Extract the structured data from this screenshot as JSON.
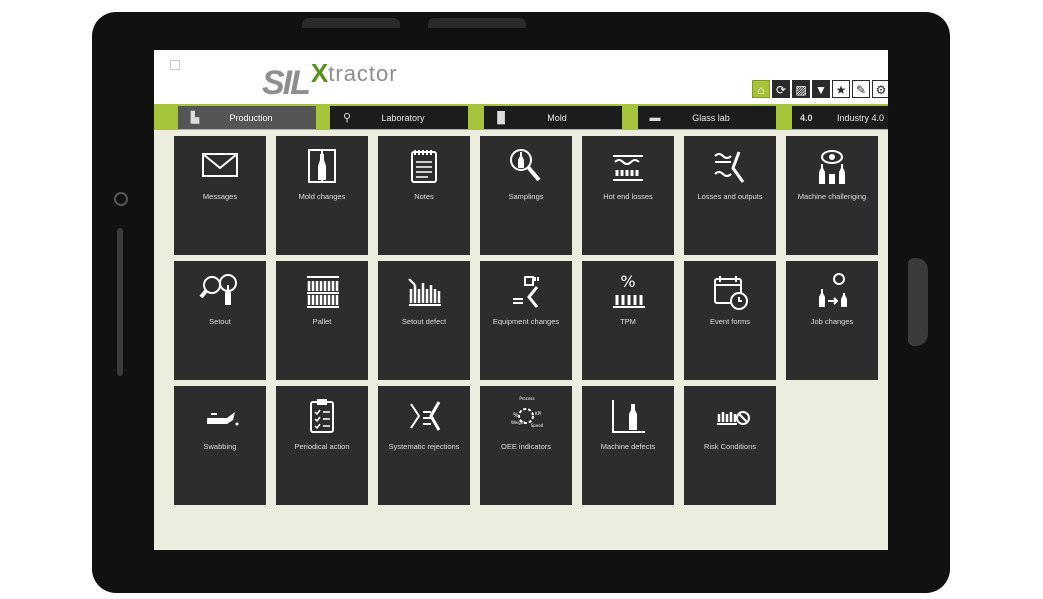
{
  "header": {
    "logo_sil": "SIL",
    "logo_x": "X",
    "logo_rest": "tractor"
  },
  "toolbar": [
    {
      "name": "home-button",
      "icon": "home-icon",
      "glyph": "⌂"
    },
    {
      "name": "refresh-button",
      "icon": "refresh-icon",
      "glyph": "⟳"
    },
    {
      "name": "image-button",
      "icon": "image-icon",
      "glyph": "▨"
    },
    {
      "name": "filter-button",
      "icon": "filter-icon",
      "glyph": "▼"
    },
    {
      "name": "favorites-button",
      "icon": "star-icon",
      "glyph": "★"
    },
    {
      "name": "edit-button",
      "icon": "edit-icon",
      "glyph": "✎"
    },
    {
      "name": "settings-button",
      "icon": "gear-icon",
      "glyph": "⚙"
    }
  ],
  "tabs": [
    {
      "label": "Production",
      "icon": "factory-icon",
      "active": true
    },
    {
      "label": "Laboratory",
      "icon": "microscope-icon",
      "active": false
    },
    {
      "label": "Mold",
      "icon": "mold-icon",
      "active": false
    },
    {
      "label": "Glass lab",
      "icon": "glass-lab-icon",
      "active": false
    },
    {
      "badge": "4.0",
      "label": "Industry 4.0",
      "active": false
    }
  ],
  "tiles": [
    {
      "label": "Messages",
      "icon": "envelope-icon"
    },
    {
      "label": "Mold changes",
      "icon": "mold-change-icon"
    },
    {
      "label": "Notes",
      "icon": "notepad-icon"
    },
    {
      "label": "Samplings",
      "icon": "magnifier-bottle-icon"
    },
    {
      "label": "Hot end losses",
      "icon": "hot-end-losses-icon"
    },
    {
      "label": "Losses and outputs",
      "icon": "losses-outputs-icon"
    },
    {
      "label": "Machine challenging",
      "icon": "eye-bottles-icon"
    },
    {
      "label": "Setout",
      "icon": "setout-icon"
    },
    {
      "label": "Pallet",
      "icon": "pallet-icon"
    },
    {
      "label": "Setout defect",
      "icon": "setout-defect-icon"
    },
    {
      "label": "Equipment changes",
      "icon": "equipment-changes-icon"
    },
    {
      "label": "TPM",
      "icon": "tpm-percent-icon"
    },
    {
      "label": "Event forms",
      "icon": "calendar-clock-icon"
    },
    {
      "label": "Job changes",
      "icon": "job-changes-icon"
    },
    {
      "label": "Swabbing",
      "icon": "oil-can-icon"
    },
    {
      "label": "Periodical action",
      "icon": "clipboard-checklist-icon"
    },
    {
      "label": "Systematic rejections",
      "icon": "rejections-icon"
    },
    {
      "label": "OEE indicators",
      "icon": "oee-gauge-icon",
      "sublabels": {
        "process": "Process",
        "kpi": "KPI",
        "weight": "Weight",
        "speed": "Speed"
      }
    },
    {
      "label": "Machine defects",
      "icon": "machine-defects-icon"
    },
    {
      "label": "Risk Conditions",
      "icon": "risk-conditions-icon"
    }
  ]
}
